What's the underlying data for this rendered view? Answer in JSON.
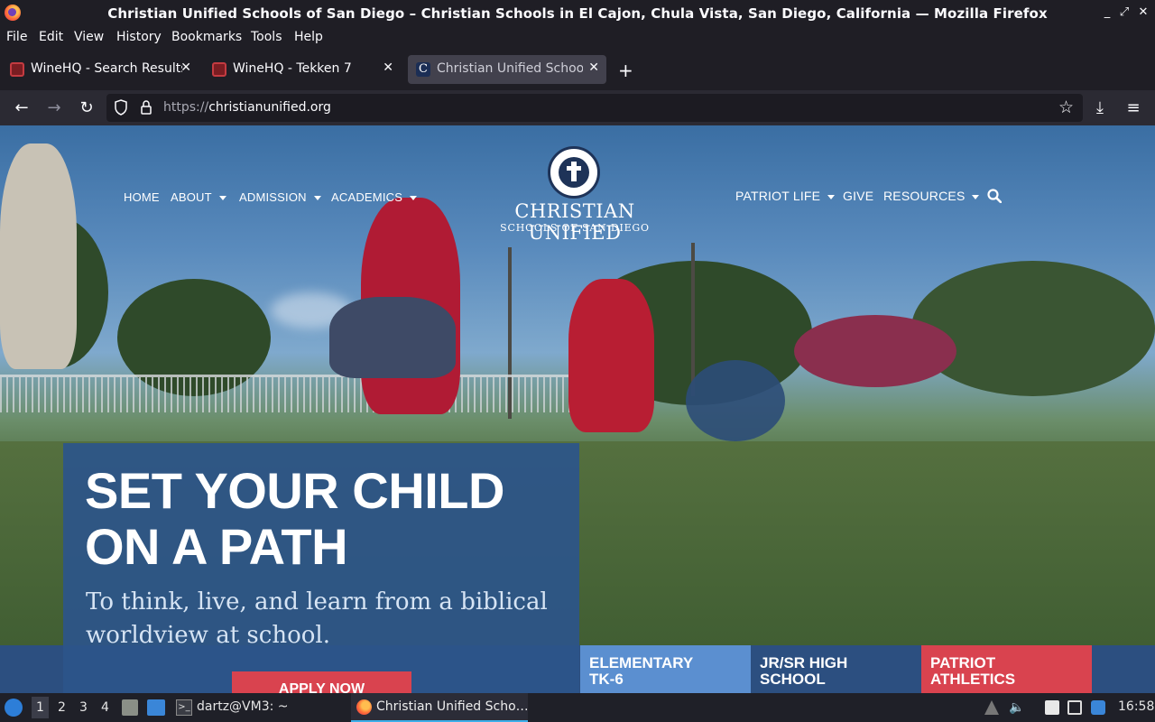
{
  "window": {
    "title": "Christian Unified Schools of San Diego – Christian Schools in El Cajon, Chula Vista, San Diego, California — Mozilla Firefox",
    "controls": [
      "minimize",
      "maximize",
      "close"
    ]
  },
  "menubar": [
    "File",
    "Edit",
    "View",
    "History",
    "Bookmarks",
    "Tools",
    "Help"
  ],
  "tabs": [
    {
      "label": "WineHQ - Search Results",
      "icon": "wine-icon",
      "active": false
    },
    {
      "label": "WineHQ - Tekken 7",
      "icon": "wine-icon",
      "active": false
    },
    {
      "label": "Christian Unified Schools",
      "icon": "cu-favicon",
      "active": true
    }
  ],
  "newtab": "+",
  "urlbar": {
    "protocol": "https://",
    "host": "christianunified.org"
  },
  "site": {
    "nav_left": [
      {
        "label": "HOME",
        "dropdown": false
      },
      {
        "label": "ABOUT",
        "dropdown": true
      },
      {
        "label": "ADMISSION",
        "dropdown": true
      },
      {
        "label": "ACADEMICS",
        "dropdown": true
      }
    ],
    "nav_right": [
      {
        "label": "PATRIOT LIFE",
        "dropdown": true
      },
      {
        "label": "GIVE",
        "dropdown": false
      },
      {
        "label": "RESOURCES",
        "dropdown": true
      }
    ],
    "logo_name": "CHRISTIAN UNIFIED",
    "logo_sub": "SCHOOLS OF SAN DIEGO",
    "hero_title_1": "SET YOUR CHILD",
    "hero_title_2": "ON A PATH",
    "hero_sub_1": "To think, live, and learn from a biblical",
    "hero_sub_2": "worldview at school.",
    "apply_label": "APPLY NOW",
    "programs": [
      {
        "line1": "ELEMENTARY",
        "line2": "TK-6",
        "color": "#5b8fd0"
      },
      {
        "line1": "JR/SR HIGH",
        "line2": "SCHOOL",
        "color": "#2c4f80"
      },
      {
        "line1": "PATRIOT",
        "line2": "ATHLETICS",
        "color": "#d9434f"
      }
    ]
  },
  "taskbar": {
    "workspaces": [
      "1",
      "2",
      "3",
      "4"
    ],
    "terminal": "dartz@VM3: ~",
    "firefox": "Christian Unified Scho…",
    "clock": "16:58"
  }
}
